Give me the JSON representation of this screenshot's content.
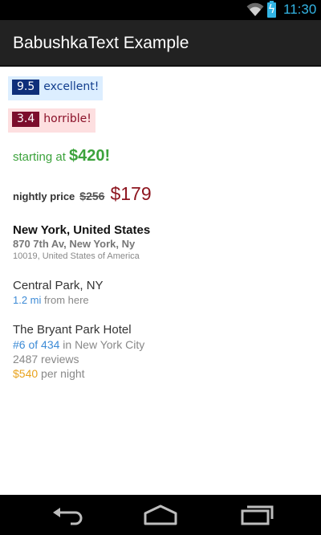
{
  "status_bar": {
    "time": "11:30",
    "icons": [
      "wifi-icon",
      "battery-charging-icon"
    ],
    "accent": "#33b5e5"
  },
  "action_bar": {
    "title": "BabushkaText Example"
  },
  "badge_good": {
    "score": "9.5",
    "label": "excellent!",
    "bg": "#dceeff",
    "accent": "#0f2f7a"
  },
  "badge_bad": {
    "score": "3.4",
    "label": "horrible!",
    "bg": "#fddfe0",
    "accent": "#7b0d2c"
  },
  "starting": {
    "prefix": "starting at ",
    "price": "$420!",
    "color": "#3ca33c"
  },
  "nightly": {
    "label": "nightly price",
    "old_price": "$256",
    "new_price": "$179",
    "new_color": "#8e1620"
  },
  "address": {
    "line1": "New York, United States",
    "line2": "870 7th Av, New York, Ny",
    "line3": "10019, United States of America"
  },
  "park": {
    "name": "Central Park, NY",
    "distance": "1.2 mi",
    "suffix": " from here",
    "distance_color": "#3d8bd6"
  },
  "hotel": {
    "name": "The Bryant Park Hotel",
    "rank": "#6 of 434",
    "rank_suffix": " in New York City",
    "reviews": "2487 reviews",
    "price": "$540",
    "price_suffix": " per night",
    "price_color": "#e8a21c"
  },
  "nav_bar": {
    "buttons": [
      "back-icon",
      "home-icon",
      "recents-icon"
    ]
  }
}
